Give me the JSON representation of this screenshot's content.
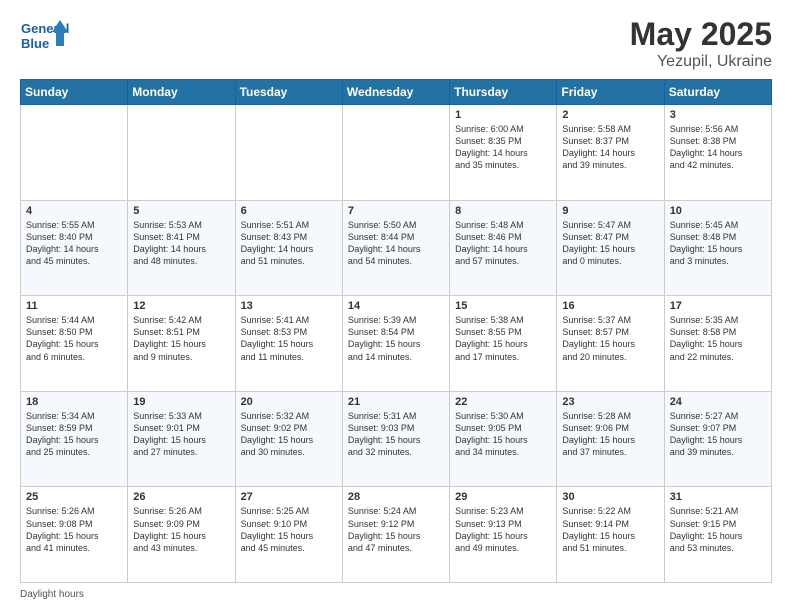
{
  "logo": {
    "line1": "General",
    "line2": "Blue"
  },
  "title": {
    "month_year": "May 2025",
    "location": "Yezupil, Ukraine"
  },
  "days_of_week": [
    "Sunday",
    "Monday",
    "Tuesday",
    "Wednesday",
    "Thursday",
    "Friday",
    "Saturday"
  ],
  "weeks": [
    [
      {
        "day": "",
        "info": ""
      },
      {
        "day": "",
        "info": ""
      },
      {
        "day": "",
        "info": ""
      },
      {
        "day": "",
        "info": ""
      },
      {
        "day": "1",
        "info": "Sunrise: 6:00 AM\nSunset: 8:35 PM\nDaylight: 14 hours\nand 35 minutes."
      },
      {
        "day": "2",
        "info": "Sunrise: 5:58 AM\nSunset: 8:37 PM\nDaylight: 14 hours\nand 39 minutes."
      },
      {
        "day": "3",
        "info": "Sunrise: 5:56 AM\nSunset: 8:38 PM\nDaylight: 14 hours\nand 42 minutes."
      }
    ],
    [
      {
        "day": "4",
        "info": "Sunrise: 5:55 AM\nSunset: 8:40 PM\nDaylight: 14 hours\nand 45 minutes."
      },
      {
        "day": "5",
        "info": "Sunrise: 5:53 AM\nSunset: 8:41 PM\nDaylight: 14 hours\nand 48 minutes."
      },
      {
        "day": "6",
        "info": "Sunrise: 5:51 AM\nSunset: 8:43 PM\nDaylight: 14 hours\nand 51 minutes."
      },
      {
        "day": "7",
        "info": "Sunrise: 5:50 AM\nSunset: 8:44 PM\nDaylight: 14 hours\nand 54 minutes."
      },
      {
        "day": "8",
        "info": "Sunrise: 5:48 AM\nSunset: 8:46 PM\nDaylight: 14 hours\nand 57 minutes."
      },
      {
        "day": "9",
        "info": "Sunrise: 5:47 AM\nSunset: 8:47 PM\nDaylight: 15 hours\nand 0 minutes."
      },
      {
        "day": "10",
        "info": "Sunrise: 5:45 AM\nSunset: 8:48 PM\nDaylight: 15 hours\nand 3 minutes."
      }
    ],
    [
      {
        "day": "11",
        "info": "Sunrise: 5:44 AM\nSunset: 8:50 PM\nDaylight: 15 hours\nand 6 minutes."
      },
      {
        "day": "12",
        "info": "Sunrise: 5:42 AM\nSunset: 8:51 PM\nDaylight: 15 hours\nand 9 minutes."
      },
      {
        "day": "13",
        "info": "Sunrise: 5:41 AM\nSunset: 8:53 PM\nDaylight: 15 hours\nand 11 minutes."
      },
      {
        "day": "14",
        "info": "Sunrise: 5:39 AM\nSunset: 8:54 PM\nDaylight: 15 hours\nand 14 minutes."
      },
      {
        "day": "15",
        "info": "Sunrise: 5:38 AM\nSunset: 8:55 PM\nDaylight: 15 hours\nand 17 minutes."
      },
      {
        "day": "16",
        "info": "Sunrise: 5:37 AM\nSunset: 8:57 PM\nDaylight: 15 hours\nand 20 minutes."
      },
      {
        "day": "17",
        "info": "Sunrise: 5:35 AM\nSunset: 8:58 PM\nDaylight: 15 hours\nand 22 minutes."
      }
    ],
    [
      {
        "day": "18",
        "info": "Sunrise: 5:34 AM\nSunset: 8:59 PM\nDaylight: 15 hours\nand 25 minutes."
      },
      {
        "day": "19",
        "info": "Sunrise: 5:33 AM\nSunset: 9:01 PM\nDaylight: 15 hours\nand 27 minutes."
      },
      {
        "day": "20",
        "info": "Sunrise: 5:32 AM\nSunset: 9:02 PM\nDaylight: 15 hours\nand 30 minutes."
      },
      {
        "day": "21",
        "info": "Sunrise: 5:31 AM\nSunset: 9:03 PM\nDaylight: 15 hours\nand 32 minutes."
      },
      {
        "day": "22",
        "info": "Sunrise: 5:30 AM\nSunset: 9:05 PM\nDaylight: 15 hours\nand 34 minutes."
      },
      {
        "day": "23",
        "info": "Sunrise: 5:28 AM\nSunset: 9:06 PM\nDaylight: 15 hours\nand 37 minutes."
      },
      {
        "day": "24",
        "info": "Sunrise: 5:27 AM\nSunset: 9:07 PM\nDaylight: 15 hours\nand 39 minutes."
      }
    ],
    [
      {
        "day": "25",
        "info": "Sunrise: 5:26 AM\nSunset: 9:08 PM\nDaylight: 15 hours\nand 41 minutes."
      },
      {
        "day": "26",
        "info": "Sunrise: 5:26 AM\nSunset: 9:09 PM\nDaylight: 15 hours\nand 43 minutes."
      },
      {
        "day": "27",
        "info": "Sunrise: 5:25 AM\nSunset: 9:10 PM\nDaylight: 15 hours\nand 45 minutes."
      },
      {
        "day": "28",
        "info": "Sunrise: 5:24 AM\nSunset: 9:12 PM\nDaylight: 15 hours\nand 47 minutes."
      },
      {
        "day": "29",
        "info": "Sunrise: 5:23 AM\nSunset: 9:13 PM\nDaylight: 15 hours\nand 49 minutes."
      },
      {
        "day": "30",
        "info": "Sunrise: 5:22 AM\nSunset: 9:14 PM\nDaylight: 15 hours\nand 51 minutes."
      },
      {
        "day": "31",
        "info": "Sunrise: 5:21 AM\nSunset: 9:15 PM\nDaylight: 15 hours\nand 53 minutes."
      }
    ]
  ],
  "footer": "Daylight hours"
}
